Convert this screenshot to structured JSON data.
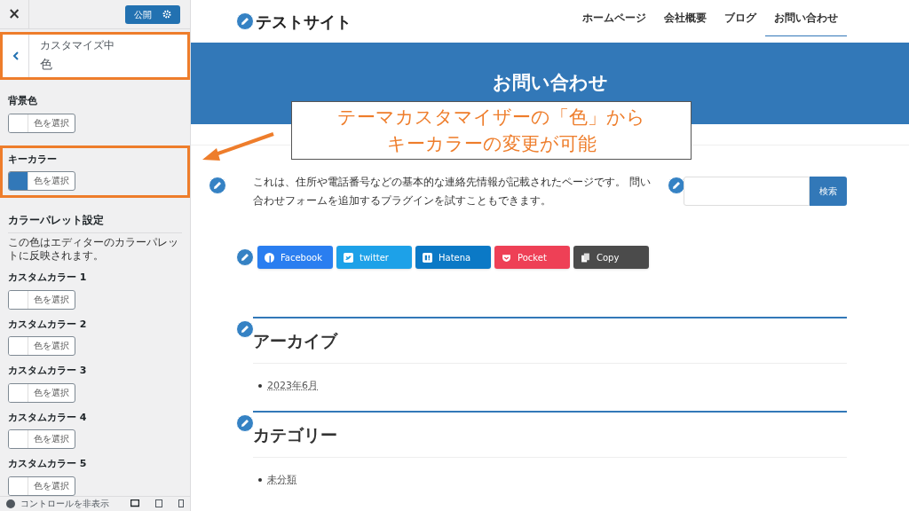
{
  "sidebar": {
    "close": "×",
    "publish": "公開",
    "section": {
      "caption": "カスタマイズ中",
      "title": "色"
    },
    "colors": [
      {
        "label": "背景色",
        "button": "色を選択",
        "color": "#ffffff",
        "highlighted": false
      },
      {
        "label": "キーカラー",
        "button": "色を選択",
        "color": "#3278b8",
        "highlighted": true
      }
    ],
    "palette": {
      "title": "カラーパレット設定",
      "description": "この色はエディターのカラーパレットに反映されます。",
      "items": [
        {
          "label": "カスタムカラー 1",
          "button": "色を選択"
        },
        {
          "label": "カスタムカラー 2",
          "button": "色を選択"
        },
        {
          "label": "カスタムカラー 3",
          "button": "色を選択"
        },
        {
          "label": "カスタムカラー 4",
          "button": "色を選択"
        },
        {
          "label": "カスタムカラー 5",
          "button": "色を選択"
        }
      ]
    },
    "footer": "コントロールを非表示"
  },
  "site": {
    "title": "テストサイト",
    "nav": [
      {
        "label": "ホームページ",
        "selected": false
      },
      {
        "label": "会社概要",
        "selected": false
      },
      {
        "label": "ブログ",
        "selected": false
      },
      {
        "label": "お問い合わせ",
        "selected": true
      }
    ],
    "page_title": "お問い合わせ",
    "body": "これは、住所や電話番号などの基本的な連絡先情報が記載されたページです。 問い合わせフォームを追加するプラグインを試すこともできます。",
    "search_button": "検索",
    "share": [
      {
        "kind": "facebook",
        "label": "Facebook",
        "color": "#2a7ef0"
      },
      {
        "kind": "twitter",
        "label": "twitter",
        "color": "#1da1e8"
      },
      {
        "kind": "hatena",
        "label": "Hatena",
        "color": "#0b79c6"
      },
      {
        "kind": "pocket",
        "label": "Pocket",
        "color": "#ee4056"
      },
      {
        "kind": "copy",
        "label": "Copy",
        "color": "#4b4b4b"
      }
    ],
    "widgets": [
      {
        "title": "アーカイブ",
        "items": [
          "2023年6月"
        ]
      },
      {
        "title": "カテゴリー",
        "items": [
          "未分類"
        ]
      }
    ]
  },
  "callout": [
    "テーマカスタマイザーの「色」から",
    "キーカラーの変更が可能"
  ]
}
